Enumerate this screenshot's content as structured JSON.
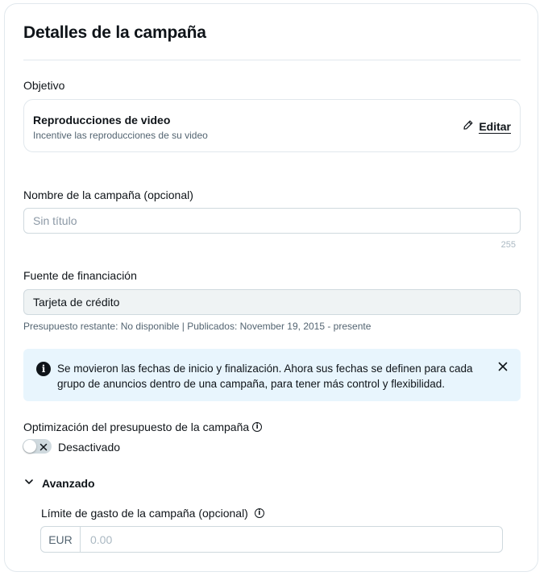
{
  "card": {
    "title": "Detalles de la campaña"
  },
  "objective": {
    "label": "Objetivo",
    "name": "Reproducciones de video",
    "description": "Incentive las reproducciones de su video",
    "edit_label": "Editar",
    "edit_icon": "pencil-icon"
  },
  "campaign_name": {
    "label": "Nombre de la campaña",
    "optional": "(opcional)",
    "placeholder": "Sin título",
    "counter": "255"
  },
  "funding": {
    "label": "Fuente de financiación",
    "value": "Tarjeta de crédito",
    "helper": "Presupuesto restante: No disponible | Publicados: November 19, 2015 - presente"
  },
  "notice": {
    "text": "Se movieron las fechas de inicio y finalización. Ahora sus fechas se definen para cada grupo de anuncios dentro de una campaña, para tener más control y flexibilidad.",
    "icon": "info-icon",
    "close_icon": "close-icon",
    "background": "#e8f5fd"
  },
  "budget_optimization": {
    "label": "Optimización del presupuesto de la campaña",
    "toggle_state": "Desactivado",
    "enabled": false
  },
  "advanced": {
    "label": "Avanzado",
    "expanded": true,
    "spend_limit": {
      "label": "Límite de gasto de la campaña",
      "optional": "(opcional)",
      "currency": "EUR",
      "placeholder": "0.00"
    }
  }
}
